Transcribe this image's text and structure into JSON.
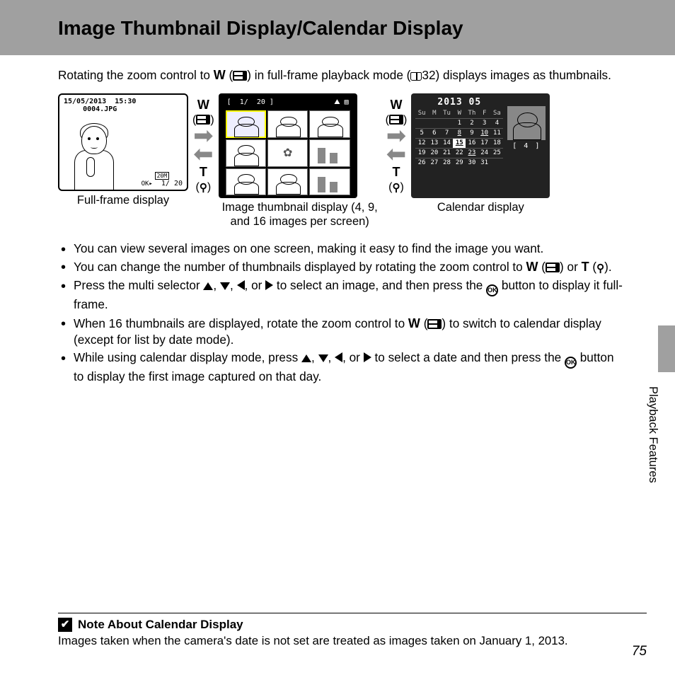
{
  "header": {
    "title": "Image Thumbnail Display/Calendar Display"
  },
  "intro": {
    "pre": "Rotating the zoom control to ",
    "mid": ") in full-frame playback mode (",
    "ref": "32",
    "post": ") displays images as thumbnails."
  },
  "figures": {
    "fullframe": {
      "date": "15/05/2013",
      "time": "15:30",
      "file": "0004.JPG",
      "counter": "1/   20",
      "size": "20M",
      "caption": "Full-frame display"
    },
    "arrow1": {
      "top": "W",
      "bot": "T"
    },
    "thumb": {
      "counter_left": "1/",
      "counter_right": "20",
      "caption": "Image thumbnail display (4, 9, and 16 images per screen)"
    },
    "arrow2": {
      "top": "W",
      "bot": "T"
    },
    "calendar": {
      "title": "2013 05",
      "dow": [
        "Su",
        "M",
        "Tu",
        "W",
        "Th",
        "F",
        "Sa"
      ],
      "weeks": [
        [
          "",
          "",
          "",
          "1",
          "2",
          "3",
          "4"
        ],
        [
          "5",
          "6",
          "7",
          "8",
          "9",
          "10",
          "11"
        ],
        [
          "12",
          "13",
          "14",
          "15",
          "16",
          "17",
          "18"
        ],
        [
          "19",
          "20",
          "21",
          "22",
          "23",
          "24",
          "25"
        ],
        [
          "26",
          "27",
          "28",
          "29",
          "30",
          "31",
          ""
        ]
      ],
      "underlined": [
        "8",
        "10",
        "15",
        "23"
      ],
      "selected": "15",
      "count": "[    4 ]",
      "caption": "Calendar display"
    }
  },
  "bullets": [
    "You can view several images on one screen, making it easy to find the image you want.",
    "bullet2_composite",
    "bullet3_composite",
    "bullet4_composite",
    "bullet5_composite"
  ],
  "bullet2": {
    "a": "You can change the number of thumbnails displayed by rotating the zoom control to ",
    "b": ") or ",
    "c": ")."
  },
  "bullet3": {
    "a": "Press the multi selector ",
    "b": ", or ",
    "c": " to select an image, and then press the ",
    "d": " button to display it full-frame."
  },
  "bullet4": {
    "a": "When 16 thumbnails are displayed, rotate the zoom control to ",
    "b": ") to switch to calendar display (except for list by date mode)."
  },
  "bullet5": {
    "a": "While using calendar display mode, press ",
    "b": ", or ",
    "c": " to select a date and then press the ",
    "d": " button to display the first image captured on that day."
  },
  "side": {
    "section": "Playback Features"
  },
  "note": {
    "title": "Note About Calendar Display",
    "body": "Images taken when the camera's date is not set are treated as images taken on January 1, 2013."
  },
  "page": "75"
}
